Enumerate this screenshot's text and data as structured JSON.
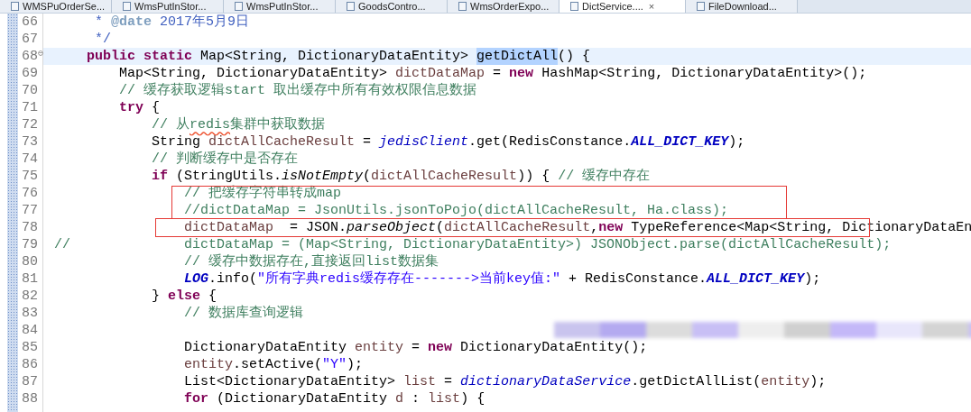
{
  "tabs": [
    {
      "label": "WMSPuOrderSe...",
      "selected": false
    },
    {
      "label": "WmsPutInStor...",
      "selected": false
    },
    {
      "label": "WmsPutInStor...",
      "selected": false
    },
    {
      "label": "GoodsContro...",
      "selected": false
    },
    {
      "label": "WmsOrderExpo...",
      "selected": false
    },
    {
      "label": "DictService....",
      "selected": true,
      "close": "×"
    },
    {
      "label": "FileDownload...",
      "selected": false
    }
  ],
  "editor": {
    "lines": [
      {
        "number": "66",
        "current": false,
        "segments": [
          {
            "kind": "javadoc",
            "text": "     * "
          },
          {
            "kind": "jdtag",
            "text": "@date"
          },
          {
            "kind": "javadoc",
            "text": " 2017年5月9日"
          }
        ]
      },
      {
        "number": "67",
        "current": false,
        "segments": [
          {
            "kind": "javadoc",
            "text": "     */"
          }
        ]
      },
      {
        "number": "68",
        "current": true,
        "fold": "⊖",
        "segments": [
          {
            "kind": "kw",
            "text": "    public static "
          },
          {
            "kind": "plain",
            "text": "Map<String, DictionaryDataEntity> "
          },
          {
            "kind": "selected",
            "text": "getDictAll"
          },
          {
            "kind": "plain",
            "text": "() {"
          }
        ]
      },
      {
        "number": "69",
        "current": false,
        "segments": [
          {
            "kind": "plain",
            "text": "        Map<String, DictionaryDataEntity> "
          },
          {
            "kind": "var",
            "text": "dictDataMap"
          },
          {
            "kind": "plain",
            "text": " = "
          },
          {
            "kind": "kw",
            "text": "new"
          },
          {
            "kind": "plain",
            "text": " HashMap<String, DictionaryDataEntity>();"
          }
        ]
      },
      {
        "number": "70",
        "current": false,
        "segments": [
          {
            "kind": "comment",
            "text": "        // 缓存获取逻辑start 取出缓存中所有有效权限信息数据"
          }
        ]
      },
      {
        "number": "71",
        "current": false,
        "segments": [
          {
            "kind": "kw",
            "text": "        try"
          },
          {
            "kind": "plain",
            "text": " {"
          }
        ]
      },
      {
        "number": "72",
        "current": false,
        "segments": [
          {
            "kind": "comment",
            "text": "            // 从"
          },
          {
            "kind": "comment",
            "text": "redis",
            "misspelled": true
          },
          {
            "kind": "comment",
            "text": "集群中获取数据"
          }
        ]
      },
      {
        "number": "73",
        "current": false,
        "segments": [
          {
            "kind": "plain",
            "text": "            String "
          },
          {
            "kind": "var",
            "text": "dictAllCacheResult"
          },
          {
            "kind": "plain",
            "text": " = "
          },
          {
            "kind": "sfield",
            "text": "jedisClient"
          },
          {
            "kind": "plain",
            "text": ".get(RedisConstance."
          },
          {
            "kind": "field",
            "text": "ALL_DICT_KEY"
          },
          {
            "kind": "plain",
            "text": ");"
          }
        ]
      },
      {
        "number": "74",
        "current": false,
        "segments": [
          {
            "kind": "comment",
            "text": "            // 判断缓存中是否存在"
          }
        ]
      },
      {
        "number": "75",
        "current": false,
        "segments": [
          {
            "kind": "kw",
            "text": "            if"
          },
          {
            "kind": "plain",
            "text": " (StringUtils."
          },
          {
            "kind": "smethod",
            "text": "isNotEmpty"
          },
          {
            "kind": "plain",
            "text": "("
          },
          {
            "kind": "var",
            "text": "dictAllCacheResult"
          },
          {
            "kind": "plain",
            "text": ")) { "
          },
          {
            "kind": "comment",
            "text": "// 缓存中存在"
          }
        ]
      },
      {
        "number": "76",
        "current": false,
        "segments": [
          {
            "kind": "comment",
            "text": "                // 把缓存字符串转成map"
          }
        ]
      },
      {
        "number": "77",
        "current": false,
        "segments": [
          {
            "kind": "comment",
            "text": "                //dictDataMap = JsonUtils.jsonToPojo(dictAllCacheResult, Ha.class);"
          }
        ]
      },
      {
        "number": "78",
        "current": false,
        "segments": [
          {
            "kind": "var",
            "text": "                dictDataMap"
          },
          {
            "kind": "plain",
            "text": "  = JSON."
          },
          {
            "kind": "smethod",
            "text": "parseObject"
          },
          {
            "kind": "plain",
            "text": "("
          },
          {
            "kind": "var",
            "text": "dictAllCacheResult"
          },
          {
            "kind": "plain",
            "text": ","
          },
          {
            "kind": "kw",
            "text": "new"
          },
          {
            "kind": "plain",
            "text": " TypeReference<Map<String, DictionaryDataEn"
          }
        ]
      },
      {
        "number": "79",
        "current": false,
        "segments": [
          {
            "kind": "comment",
            "text": "//              dictDataMap = (Map<String, DictionaryDataEntity>) JSONObject.parse(dictAllCacheResult);"
          }
        ]
      },
      {
        "number": "80",
        "current": false,
        "segments": [
          {
            "kind": "comment",
            "text": "                // 缓存中数据存在,直接返回list数据集"
          }
        ]
      },
      {
        "number": "81",
        "current": false,
        "segments": [
          {
            "kind": "field",
            "text": "                LOG"
          },
          {
            "kind": "plain",
            "text": ".info("
          },
          {
            "kind": "string",
            "text": "\"所有字典redis缓存存在------->当前key值:\""
          },
          {
            "kind": "plain",
            "text": " + RedisConstance."
          },
          {
            "kind": "field",
            "text": "ALL_DICT_KEY"
          },
          {
            "kind": "plain",
            "text": ");"
          }
        ]
      },
      {
        "number": "82",
        "current": false,
        "segments": [
          {
            "kind": "plain",
            "text": "            } "
          },
          {
            "kind": "kw",
            "text": "else"
          },
          {
            "kind": "plain",
            "text": " {"
          }
        ]
      },
      {
        "number": "83",
        "current": false,
        "segments": [
          {
            "kind": "comment",
            "text": "                // 数据库查询逻辑"
          }
        ]
      },
      {
        "number": "84",
        "current": false,
        "kind": "redacted"
      },
      {
        "number": "85",
        "current": false,
        "segments": [
          {
            "kind": "plain",
            "text": "                DictionaryDataEntity "
          },
          {
            "kind": "var",
            "text": "entity"
          },
          {
            "kind": "plain",
            "text": " = "
          },
          {
            "kind": "kw",
            "text": "new"
          },
          {
            "kind": "plain",
            "text": " DictionaryDataEntity();"
          }
        ]
      },
      {
        "number": "86",
        "current": false,
        "segments": [
          {
            "kind": "var",
            "text": "                entity"
          },
          {
            "kind": "plain",
            "text": ".setActive("
          },
          {
            "kind": "string",
            "text": "\"Y\""
          },
          {
            "kind": "plain",
            "text": ");"
          }
        ]
      },
      {
        "number": "87",
        "current": false,
        "segments": [
          {
            "kind": "plain",
            "text": "                List<DictionaryDataEntity> "
          },
          {
            "kind": "var",
            "text": "list"
          },
          {
            "kind": "plain",
            "text": " = "
          },
          {
            "kind": "sfield",
            "text": "dictionaryDataService"
          },
          {
            "kind": "plain",
            "text": ".getDictAllList("
          },
          {
            "kind": "var",
            "text": "entity"
          },
          {
            "kind": "plain",
            "text": ");"
          }
        ]
      },
      {
        "number": "88",
        "current": false,
        "segments": [
          {
            "kind": "kw",
            "text": "                for"
          },
          {
            "kind": "plain",
            "text": " (DictionaryDataEntity "
          },
          {
            "kind": "var",
            "text": "d"
          },
          {
            "kind": "plain",
            "text": " : "
          },
          {
            "kind": "var",
            "text": "list"
          },
          {
            "kind": "plain",
            "text": ") {"
          }
        ]
      }
    ]
  }
}
